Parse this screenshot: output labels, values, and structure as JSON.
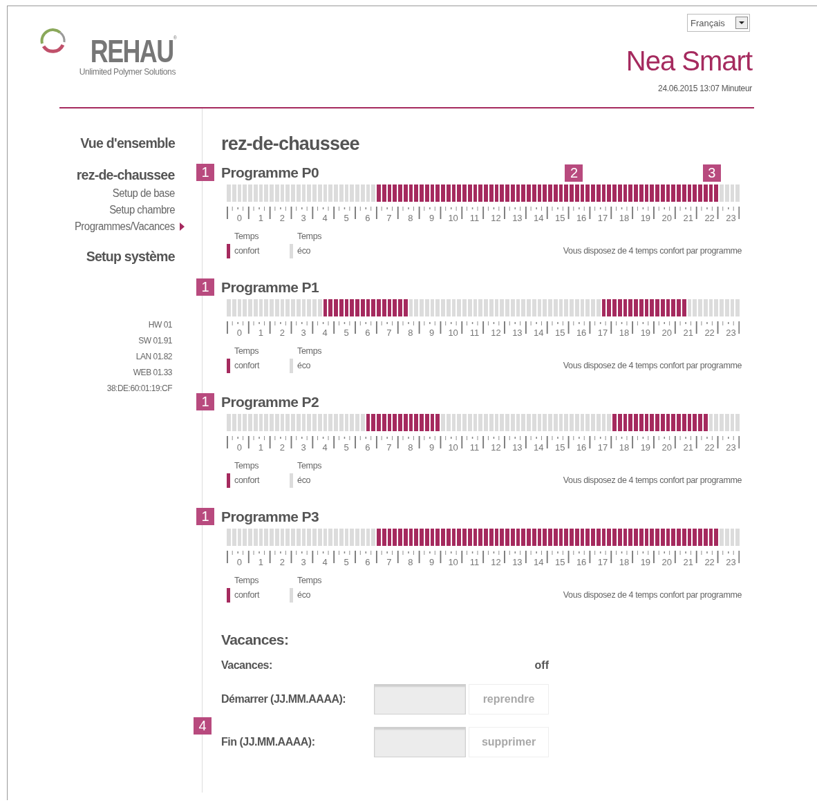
{
  "header": {
    "logo": {
      "name": "REHAU",
      "registered": "®",
      "tagline": "Unlimited Polymer Solutions"
    },
    "language": "Français",
    "product": "Nea Smart",
    "status": "24.06.2015 13:07 Minuteur"
  },
  "sidebar": {
    "items": [
      {
        "label": "Vue d'ensemble",
        "kind": "heading",
        "selected": false
      },
      {
        "label": "rez-de-chaussee",
        "kind": "heading",
        "selected": false
      },
      {
        "label": "Setup de base",
        "kind": "sub",
        "selected": false
      },
      {
        "label": "Setup chambre",
        "kind": "sub",
        "selected": false
      },
      {
        "label": "Programmes/Vacances",
        "kind": "sub",
        "selected": true
      },
      {
        "label": "Setup système",
        "kind": "heading",
        "selected": false
      }
    ],
    "versions": [
      "HW 01",
      "SW 01.91",
      "LAN 01.82",
      "WEB 01.33",
      "38:DE:60:01:19:CF"
    ]
  },
  "page_title": "rez-de-chaussee",
  "programs": [
    {
      "badge": "1",
      "title": "Programme P0",
      "callouts": [
        {
          "label": "2"
        },
        {
          "label": "3"
        }
      ],
      "slots": [
        false,
        false,
        false,
        false,
        false,
        false,
        false,
        false,
        false,
        false,
        false,
        false,
        false,
        false,
        false,
        false,
        false,
        false,
        false,
        false,
        false,
        false,
        false,
        false,
        false,
        false,
        false,
        false,
        true,
        true,
        true,
        true,
        true,
        true,
        true,
        true,
        true,
        true,
        true,
        true,
        true,
        true,
        true,
        true,
        true,
        true,
        true,
        true,
        true,
        true,
        true,
        true,
        true,
        true,
        true,
        true,
        true,
        true,
        true,
        true,
        true,
        true,
        true,
        true,
        true,
        true,
        true,
        true,
        true,
        true,
        true,
        true,
        true,
        true,
        true,
        true,
        true,
        true,
        true,
        true,
        true,
        true,
        true,
        true,
        true,
        true,
        true,
        true,
        true,
        true,
        true,
        true,
        false,
        false,
        false,
        false
      ],
      "hour_labels": [
        "0",
        "1",
        "2",
        "3",
        "4",
        "5",
        "6",
        "7",
        "8",
        "9",
        "10",
        "11",
        "12",
        "13",
        "14",
        "15",
        "16",
        "17",
        "18",
        "19",
        "20",
        "21",
        "22",
        "23"
      ],
      "legend": [
        {
          "label": "Temps confort",
          "kind": "comfort"
        },
        {
          "label": "Temps éco",
          "kind": "eco"
        }
      ],
      "note": "Vous disposez de 4 temps confort par programme"
    },
    {
      "badge": "1",
      "title": "Programme P1",
      "slots": [
        false,
        false,
        false,
        false,
        false,
        false,
        false,
        false,
        false,
        false,
        false,
        false,
        false,
        false,
        false,
        false,
        false,
        false,
        true,
        true,
        true,
        true,
        true,
        true,
        true,
        true,
        true,
        true,
        true,
        true,
        true,
        true,
        true,
        true,
        false,
        false,
        false,
        false,
        false,
        false,
        false,
        false,
        false,
        false,
        false,
        false,
        false,
        false,
        false,
        false,
        false,
        false,
        false,
        false,
        false,
        false,
        false,
        false,
        false,
        false,
        false,
        false,
        false,
        false,
        false,
        false,
        false,
        false,
        false,
        false,
        true,
        true,
        true,
        true,
        true,
        true,
        true,
        true,
        true,
        true,
        true,
        true,
        true,
        true,
        true,
        true,
        false,
        false,
        false,
        false,
        false,
        false,
        false,
        false,
        false,
        false
      ],
      "hour_labels": [
        "0",
        "1",
        "2",
        "3",
        "4",
        "5",
        "6",
        "7",
        "8",
        "9",
        "10",
        "11",
        "12",
        "13",
        "14",
        "15",
        "16",
        "17",
        "18",
        "19",
        "20",
        "21",
        "22",
        "23"
      ],
      "legend": [
        {
          "label": "Temps confort",
          "kind": "comfort"
        },
        {
          "label": "Temps éco",
          "kind": "eco"
        }
      ],
      "note": "Vous disposez de 4 temps confort par programme"
    },
    {
      "badge": "1",
      "title": "Programme P2",
      "slots": [
        false,
        false,
        false,
        false,
        false,
        false,
        false,
        false,
        false,
        false,
        false,
        false,
        false,
        false,
        false,
        false,
        false,
        false,
        false,
        false,
        false,
        false,
        false,
        false,
        false,
        false,
        true,
        true,
        true,
        true,
        true,
        true,
        true,
        true,
        true,
        true,
        true,
        true,
        true,
        true,
        false,
        false,
        false,
        false,
        false,
        false,
        false,
        false,
        false,
        false,
        false,
        false,
        false,
        false,
        false,
        false,
        false,
        false,
        false,
        false,
        false,
        false,
        false,
        false,
        false,
        false,
        false,
        false,
        false,
        false,
        false,
        false,
        true,
        true,
        true,
        true,
        true,
        true,
        true,
        true,
        true,
        true,
        true,
        true,
        true,
        true,
        true,
        true,
        true,
        true,
        false,
        false,
        false,
        false,
        false,
        false
      ],
      "hour_labels": [
        "0",
        "1",
        "2",
        "3",
        "4",
        "5",
        "6",
        "7",
        "8",
        "9",
        "10",
        "11",
        "12",
        "13",
        "14",
        "15",
        "16",
        "17",
        "18",
        "19",
        "20",
        "21",
        "22",
        "23"
      ],
      "legend": [
        {
          "label": "Temps confort",
          "kind": "comfort"
        },
        {
          "label": "Temps éco",
          "kind": "eco"
        }
      ],
      "note": "Vous disposez de 4 temps confort par programme"
    },
    {
      "badge": "1",
      "title": "Programme P3",
      "slots": [
        false,
        false,
        false,
        false,
        false,
        false,
        false,
        false,
        false,
        false,
        false,
        false,
        false,
        false,
        false,
        false,
        false,
        false,
        false,
        false,
        false,
        false,
        false,
        false,
        false,
        false,
        false,
        false,
        true,
        true,
        true,
        true,
        true,
        true,
        true,
        true,
        true,
        true,
        true,
        true,
        true,
        true,
        true,
        true,
        true,
        true,
        true,
        true,
        true,
        true,
        true,
        true,
        true,
        true,
        true,
        true,
        true,
        true,
        true,
        true,
        true,
        true,
        true,
        true,
        true,
        true,
        true,
        true,
        true,
        true,
        true,
        true,
        true,
        true,
        true,
        true,
        true,
        true,
        true,
        true,
        true,
        true,
        true,
        true,
        true,
        true,
        true,
        true,
        true,
        true,
        true,
        true,
        false,
        false,
        false,
        false
      ],
      "hour_labels": [
        "0",
        "1",
        "2",
        "3",
        "4",
        "5",
        "6",
        "7",
        "8",
        "9",
        "10",
        "11",
        "12",
        "13",
        "14",
        "15",
        "16",
        "17",
        "18",
        "19",
        "20",
        "21",
        "22",
        "23"
      ],
      "legend": [
        {
          "label": "Temps confort",
          "kind": "comfort"
        },
        {
          "label": "Temps éco",
          "kind": "eco"
        }
      ],
      "note": "Vous disposez de 4 temps confort par programme"
    }
  ],
  "vacation": {
    "title": "Vacances:",
    "badge": "4",
    "status_label": "Vacances:",
    "status": "off",
    "fields": [
      {
        "label": "Démarrer (JJ.MM.AAAA):",
        "button": "reprendre",
        "disabled": true
      },
      {
        "label": "Fin (JJ.MM.AAAA):",
        "button": "supprimer",
        "disabled": true
      }
    ]
  }
}
